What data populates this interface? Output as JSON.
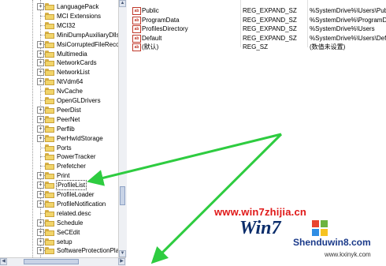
{
  "tree": {
    "items": [
      {
        "label": "LanguagePack",
        "expandable": true
      },
      {
        "label": "MCI Extensions",
        "expandable": false
      },
      {
        "label": "MCI32",
        "expandable": false
      },
      {
        "label": "MiniDumpAuxiliaryDlls",
        "expandable": false
      },
      {
        "label": "MsiCorruptedFileReco",
        "expandable": true
      },
      {
        "label": "Multimedia",
        "expandable": true
      },
      {
        "label": "NetworkCards",
        "expandable": true
      },
      {
        "label": "NetworkList",
        "expandable": true
      },
      {
        "label": "NtVdm64",
        "expandable": true
      },
      {
        "label": "NvCache",
        "expandable": false
      },
      {
        "label": "OpenGLDrivers",
        "expandable": false
      },
      {
        "label": "PeerDist",
        "expandable": true
      },
      {
        "label": "PeerNet",
        "expandable": true
      },
      {
        "label": "Perflib",
        "expandable": true
      },
      {
        "label": "PerHwIdStorage",
        "expandable": true
      },
      {
        "label": "Ports",
        "expandable": false
      },
      {
        "label": "PowerTracker",
        "expandable": false
      },
      {
        "label": "Prefetcher",
        "expandable": false
      },
      {
        "label": "Print",
        "expandable": true
      },
      {
        "label": "ProfileList",
        "expandable": true,
        "selected": true
      },
      {
        "label": "ProfileLoader",
        "expandable": true
      },
      {
        "label": "ProfileNotification",
        "expandable": true
      },
      {
        "label": "related.desc",
        "expandable": false
      },
      {
        "label": "Schedule",
        "expandable": true
      },
      {
        "label": "SeCEdit",
        "expandable": true
      },
      {
        "label": "setup",
        "expandable": true
      },
      {
        "label": "SoftwareProtectionPla",
        "expandable": true
      }
    ]
  },
  "values": {
    "rows": [
      {
        "icon": "ab",
        "name": "Public",
        "type": "REG_EXPAND_SZ",
        "data": "%SystemDrive%\\Users\\Pub"
      },
      {
        "icon": "ab",
        "name": "ProgramData",
        "type": "REG_EXPAND_SZ",
        "data": "%SystemDrive%\\ProgramD"
      },
      {
        "icon": "ab",
        "name": "ProfilesDirectory",
        "type": "REG_EXPAND_SZ",
        "data": "%SystemDrive%\\Users"
      },
      {
        "icon": "ab",
        "name": "Default",
        "type": "REG_EXPAND_SZ",
        "data": "%SystemDrive%\\Users\\Def"
      },
      {
        "icon": "ab",
        "name": "(默认)",
        "type": "REG_SZ",
        "data": "(数值未设置)"
      }
    ]
  },
  "watermark": {
    "url": "www.win7zhijia.cn",
    "logo": "Win7",
    "brand": "Shenduwin8.com",
    "url2": "www.kxinyk.com"
  },
  "colors": {
    "arrow": "#2ecc40",
    "watermark_red": "#e01818",
    "folder_yellow": "#f1d46a"
  }
}
